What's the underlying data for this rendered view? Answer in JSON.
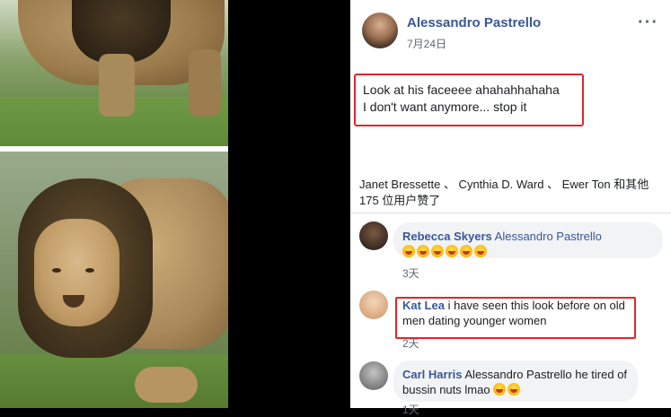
{
  "post": {
    "author": "Alessandro Pastrello",
    "date": "7月24日",
    "more_icon": "···",
    "text": "Look at his faceeee ahahahhahaha\nI don't want anymore... stop it",
    "likes_summary": "Janet Bressette 、 Cynthia D. Ward 、 Ewer Ton 和其他 175 位用户赞了"
  },
  "comments": [
    {
      "name": "Rebecca Skyers",
      "text": "Alessandro Pastrello",
      "emoji_count": 6,
      "time": "3天"
    },
    {
      "name": "Kat Lea",
      "text": "i have seen this look before on old men dating younger women",
      "time": "2天"
    },
    {
      "name": "Carl Harris",
      "text": "Alessandro Pastrello he tired of bussin nuts lmao",
      "emoji_count": 2,
      "time": "1天"
    }
  ],
  "colors": {
    "link": "#385898",
    "highlight_box": "#e0262b",
    "bubble": "#f2f3f5"
  }
}
